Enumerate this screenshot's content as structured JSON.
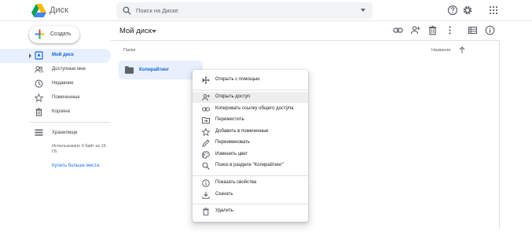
{
  "app": {
    "title": "Диск"
  },
  "search": {
    "placeholder": "Поиск на Диске"
  },
  "header_icons": [
    "help-icon",
    "settings-icon",
    "apps-icon"
  ],
  "new_button": {
    "label": "Создать"
  },
  "sidebar": {
    "items": [
      {
        "label": "Мой диск",
        "icon": "my-drive-icon",
        "active": true
      },
      {
        "label": "Доступные мне",
        "icon": "shared-icon"
      },
      {
        "label": "Недавние",
        "icon": "clock-icon"
      },
      {
        "label": "Помеченные",
        "icon": "star-icon"
      },
      {
        "label": "Корзина",
        "icon": "trash-icon"
      }
    ],
    "storage": {
      "label": "Хранилище",
      "usage": "Использовано 0 байт из 15 ГБ",
      "buy_link": "Купить больше места"
    }
  },
  "main": {
    "title": "Мой диск",
    "toolbar_icons": [
      "link-icon",
      "add-person-icon",
      "trash-icon",
      "more-vert-icon",
      "list-view-icon",
      "info-icon"
    ],
    "section_label": "Папки",
    "sort": {
      "label": "Название",
      "direction": "ascending"
    },
    "folders": [
      {
        "name": "Копирайтинг"
      }
    ]
  },
  "context_menu": {
    "items": [
      {
        "label": "Открыть с помощью",
        "icon": "open-with-icon",
        "submenu": true
      },
      {
        "label": "Открыть доступ",
        "icon": "share-icon",
        "highlighted": true
      },
      {
        "label": "Копировать ссылку общего доступа",
        "icon": "link-icon"
      },
      {
        "label": "Переместить",
        "icon": "move-icon"
      },
      {
        "label": "Добавить в помеченные",
        "icon": "star-icon"
      },
      {
        "label": "Переименовать",
        "icon": "rename-icon"
      },
      {
        "label": "Изменить цвет",
        "icon": "palette-icon",
        "submenu": true
      },
      {
        "label": "Поиск в разделе \"Копирайтинг\"",
        "icon": "search-icon"
      },
      {
        "label": "Показать свойства",
        "icon": "info-icon"
      },
      {
        "label": "Скачать",
        "icon": "download-icon"
      },
      {
        "label": "Удалить",
        "icon": "trash-icon"
      }
    ]
  },
  "colors": {
    "accent": "#1a73e8",
    "active_bg": "#e8f0fe",
    "active_text": "#1967d2",
    "icon": "#5f6368"
  }
}
